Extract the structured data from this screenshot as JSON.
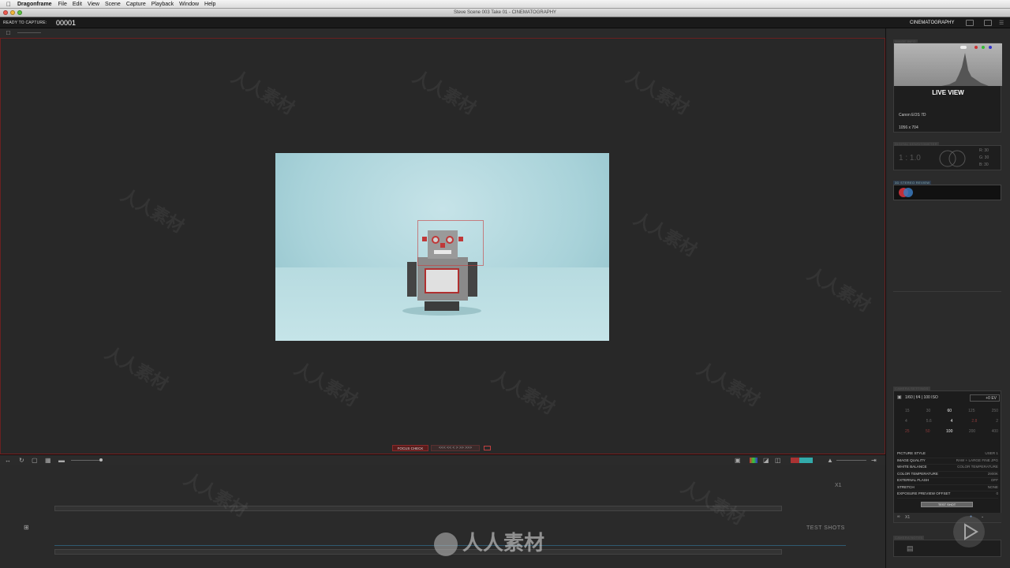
{
  "menubar": {
    "app_name": "Dragonframe",
    "items": [
      "File",
      "Edit",
      "View",
      "Scene",
      "Capture",
      "Playback",
      "Window",
      "Help"
    ]
  },
  "window": {
    "title": "Steve  Scene 003  Take 01 - CINEMATOGRAPHY"
  },
  "toolbar": {
    "ready_label": "READY TO CAPTURE:",
    "frame_number": "00001",
    "workspace": "CINEMATOGRAPHY"
  },
  "viewer": {
    "focus_check_label": "FOCUS CHECK",
    "focus_arrows": "<<<  <<  <  >  >>  >>>"
  },
  "timeline": {
    "exposure_label": "X1",
    "test_shots_label": "TEST SHOTS"
  },
  "right_panel": {
    "image_info": {
      "title": "IMAGE INFO",
      "mode": "LIVE VIEW",
      "camera_model": "Canon EOS 7D",
      "resolution": "1056 x 704"
    },
    "densitometer": {
      "title": "DIGITAL DENSITOMETER",
      "ratio": "1 : 1.0",
      "r": "R:  30",
      "g": "G:  30",
      "b": "B:  30"
    },
    "stereo": {
      "title": "3D STEREO REVIEW"
    },
    "camera_settings": {
      "title": "CAMERA SETTINGS",
      "exposure_readout": "1/60 | f/4 | 100 ISO",
      "ev": "+0 EV",
      "shutter_scale": [
        "15",
        "30",
        "60",
        "125",
        "250"
      ],
      "aperture_scale": [
        "4",
        "5.6",
        "4",
        "2.8",
        "2"
      ],
      "iso_scale": [
        "25",
        "50",
        "100",
        "200",
        "400"
      ],
      "settings": [
        {
          "label": "PICTURE STYLE",
          "value": "USER 1"
        },
        {
          "label": "IMAGE QUALITY",
          "value": "RAW + LARGE FINE JPG"
        },
        {
          "label": "WHITE BALANCE",
          "value": "COLOR TEMPERATURE"
        },
        {
          "label": "COLOR TEMPERATURE",
          "value": "2900K"
        },
        {
          "label": "EXTERNAL FLASH",
          "value": "OFF"
        },
        {
          "label": "STRETCH",
          "value": "NONE"
        },
        {
          "label": "EXPOSURE PREVIEW OFFSET",
          "value": "0"
        }
      ],
      "test_shot_label": "TEST SHOT",
      "footer_exposure": "X1"
    },
    "notes": {
      "title": "CAMERA NOTES"
    }
  },
  "watermark": {
    "text": "人人素材"
  },
  "colors": {
    "accent_red": "#8a2a2a",
    "stereo_red": "#c0303a",
    "stereo_blue": "#3a7ac0"
  }
}
